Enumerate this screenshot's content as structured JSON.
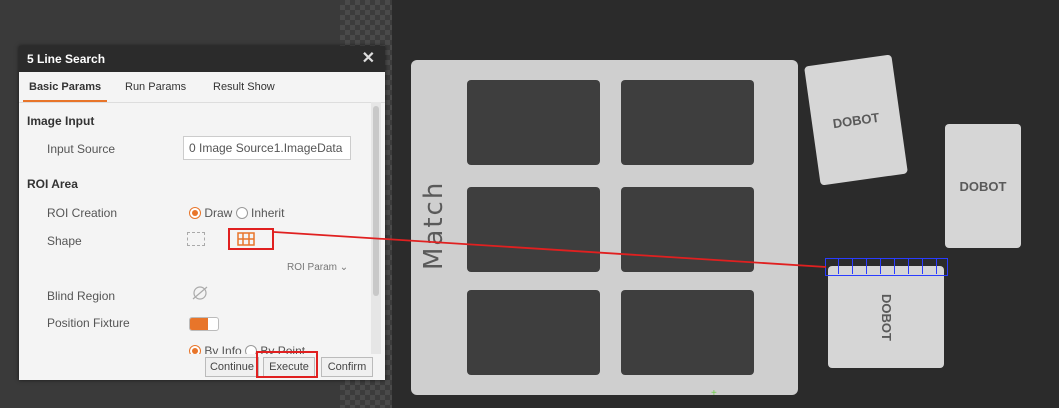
{
  "dialog": {
    "title": "5 Line Search",
    "close_icon": "close-icon",
    "tabs": [
      "Basic Params",
      "Run Params",
      "Result Show"
    ],
    "image_input": {
      "section": "Image Input",
      "input_source_label": "Input Source",
      "input_source_value": "0 Image Source1.ImageData"
    },
    "roi_area": {
      "section": "ROI Area",
      "roi_creation_label": "ROI Creation",
      "roi_options": [
        "Draw",
        "Inherit"
      ],
      "roi_selected": "Draw",
      "shape_label": "Shape",
      "roi_param_link": "ROI Param",
      "blind_region_label": "Blind Region",
      "position_fixture_label": "Position Fixture",
      "position_fixture_on": true,
      "fixture_options": [
        "By Info",
        "By Point"
      ],
      "fixture_selected": "By Info"
    },
    "buttons": {
      "continue": "Continue",
      "execute": "Execute",
      "confirm": "Confirm"
    }
  },
  "image_view": {
    "plate_label": "Match",
    "cards": [
      "DOBOT",
      "DOBOT",
      "DOBOT"
    ]
  },
  "colors": {
    "accent": "#e8752a",
    "highlight": "#e02020",
    "roi": "#2a3cff"
  }
}
